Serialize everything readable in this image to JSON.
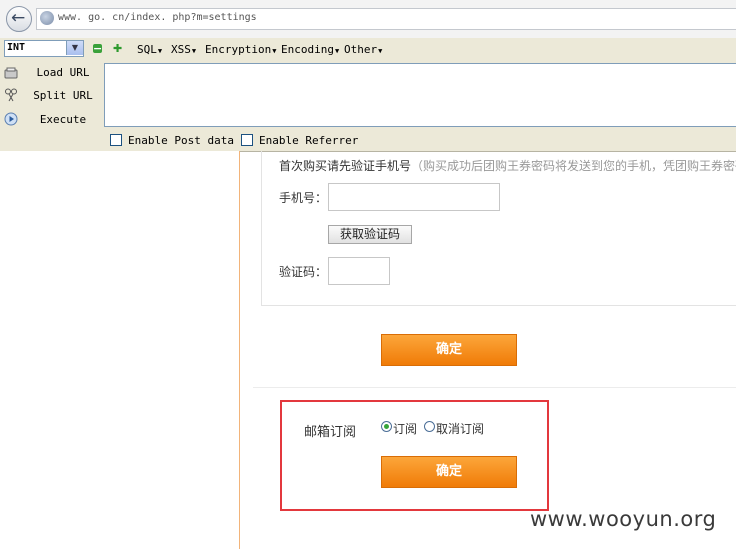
{
  "browser": {
    "url": "www. go. cn/index. php?m=settings"
  },
  "hackbar": {
    "select_value": "INT",
    "menus": [
      "SQL",
      "XSS",
      "Encryption",
      "Encoding",
      "Other"
    ],
    "actions": [
      "Load URL",
      "Split URL",
      "Execute"
    ],
    "checkboxes": [
      "Enable Post data",
      "Enable Referrer"
    ]
  },
  "form": {
    "notice_title": "首次购买请先验证手机号",
    "notice_hint": "（购买成功后团购王券密码将发送到您的手机，凭团购王券密码",
    "phone_label": "手机号：",
    "get_code_label": "获取验证码",
    "code_label": "验证码：",
    "confirm_label": "确定"
  },
  "subscription": {
    "label": "邮箱订阅",
    "options": [
      "订阅",
      "取消订阅"
    ],
    "selected": "订阅",
    "confirm_label": "确定"
  },
  "watermark": "www.wooyun.org"
}
